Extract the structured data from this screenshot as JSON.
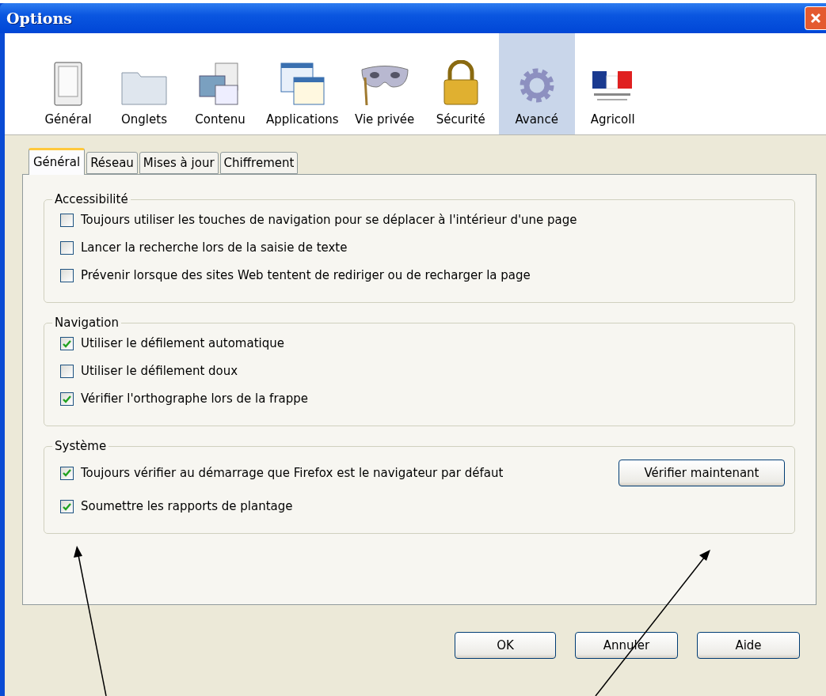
{
  "window": {
    "title": "Options"
  },
  "toolbar": [
    {
      "label": "Général",
      "kind": "switch",
      "selected": false
    },
    {
      "label": "Onglets",
      "kind": "folder",
      "selected": false
    },
    {
      "label": "Contenu",
      "kind": "content",
      "selected": false
    },
    {
      "label": "Applications",
      "kind": "apps",
      "selected": false
    },
    {
      "label": "Vie privée",
      "kind": "mask",
      "selected": false
    },
    {
      "label": "Sécurité",
      "kind": "lock",
      "selected": false
    },
    {
      "label": "Avancé",
      "kind": "gear",
      "selected": true
    },
    {
      "label": "Agricoll",
      "kind": "flag",
      "selected": false
    }
  ],
  "tabs": [
    {
      "label": "Général",
      "selected": true
    },
    {
      "label": "Réseau",
      "selected": false
    },
    {
      "label": "Mises à jour",
      "selected": false
    },
    {
      "label": "Chiffrement",
      "selected": false
    }
  ],
  "groups": [
    {
      "title": "Accessibilité",
      "options": [
        {
          "label": "Toujours utiliser les touches de navigation pour se déplacer à l'intérieur d'une page",
          "checked": false
        },
        {
          "label": "Lancer la recherche lors de la saisie de texte",
          "checked": false
        },
        {
          "label": "Prévenir lorsque des sites Web tentent de rediriger ou de recharger la page",
          "checked": false
        }
      ]
    },
    {
      "title": "Navigation",
      "options": [
        {
          "label": "Utiliser le défilement automatique",
          "checked": true
        },
        {
          "label": "Utiliser le défilement doux",
          "checked": false
        },
        {
          "label": "Vérifier l'orthographe lors de la frappe",
          "checked": true
        }
      ]
    },
    {
      "title": "Système",
      "button": "Vérifier maintenant",
      "options": [
        {
          "label": "Toujours vérifier au démarrage que Firefox est le navigateur par défaut",
          "checked": true
        },
        {
          "label": "Soumettre les rapports de plantage",
          "checked": true
        }
      ]
    }
  ],
  "buttons": [
    "OK",
    "Annuler",
    "Aide"
  ]
}
